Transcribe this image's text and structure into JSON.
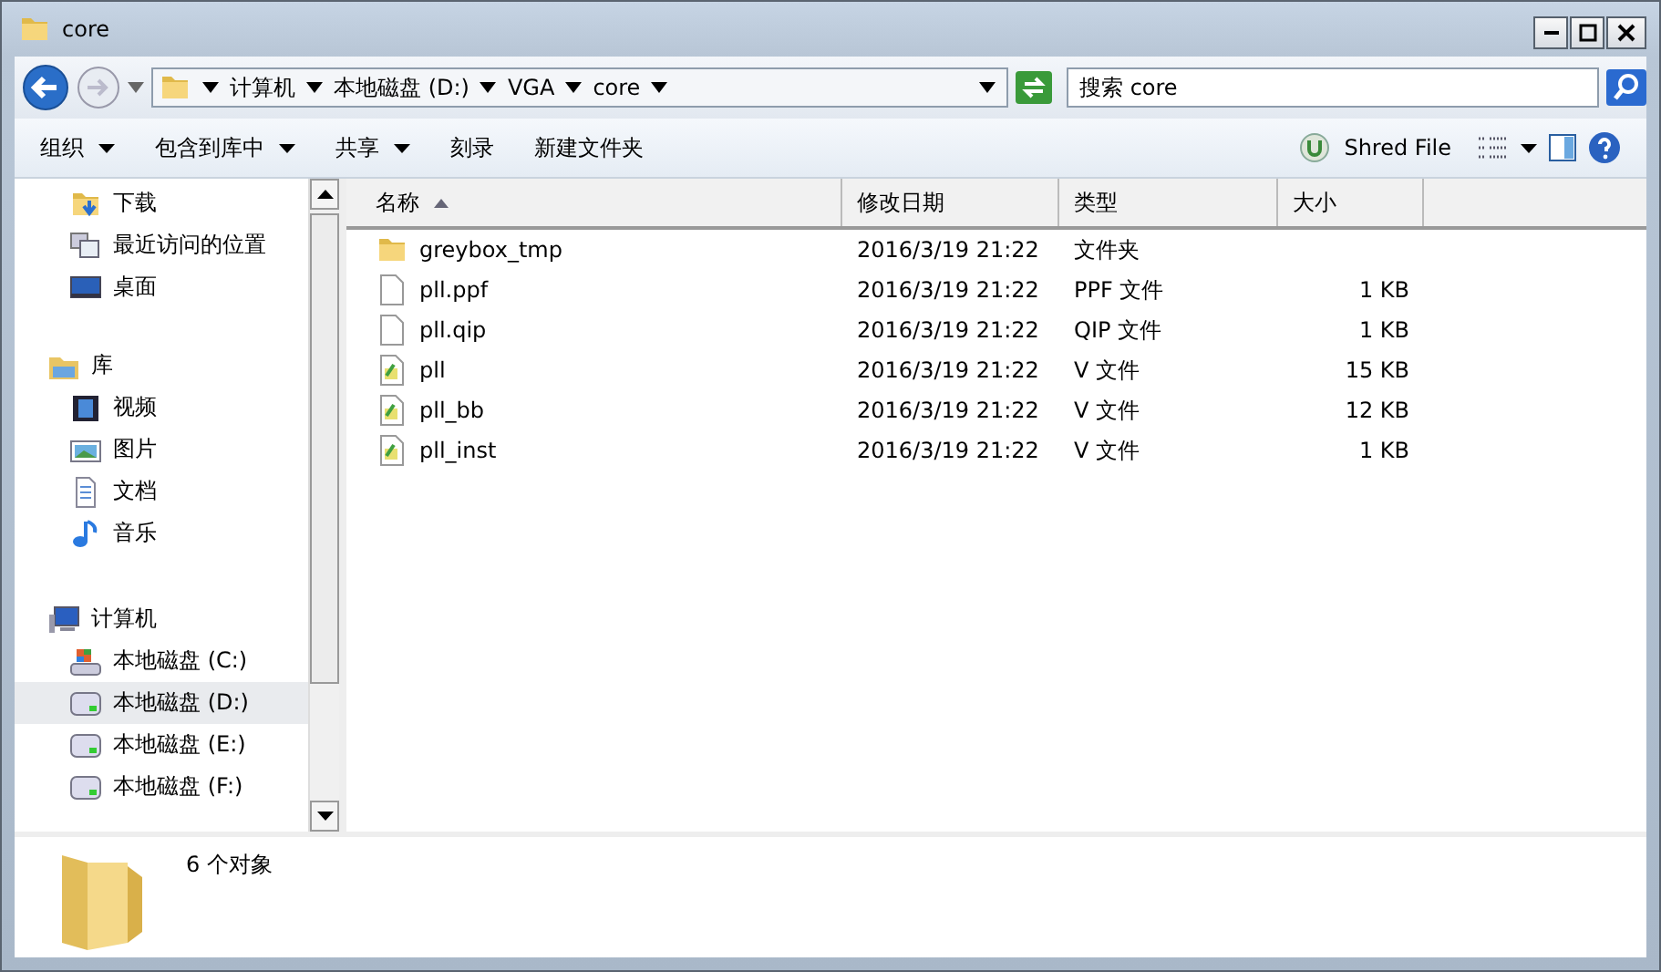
{
  "window": {
    "title": "core"
  },
  "address": {
    "crumbs": [
      "计算机",
      "本地磁盘 (D:)",
      "VGA",
      "core"
    ]
  },
  "search": {
    "placeholder": "搜索 core"
  },
  "toolbar": {
    "items": [
      {
        "label": "组织",
        "dropdown": true
      },
      {
        "label": "包含到库中",
        "dropdown": true
      },
      {
        "label": "共享",
        "dropdown": true
      },
      {
        "label": "刻录",
        "dropdown": false
      },
      {
        "label": "新建文件夹",
        "dropdown": false
      }
    ],
    "shred": "Shred File"
  },
  "sidebar": {
    "groups": [
      {
        "kind": "favorites",
        "children": [
          {
            "label": "下载",
            "kind": "download",
            "selected": false
          },
          {
            "label": "最近访问的位置",
            "kind": "recent",
            "selected": false
          },
          {
            "label": "桌面",
            "kind": "desktop",
            "selected": false
          }
        ]
      },
      {
        "label": "库",
        "kind": "library",
        "children": [
          {
            "label": "视频",
            "kind": "video",
            "selected": false
          },
          {
            "label": "图片",
            "kind": "picture",
            "selected": false
          },
          {
            "label": "文档",
            "kind": "document",
            "selected": false
          },
          {
            "label": "音乐",
            "kind": "music",
            "selected": false
          }
        ]
      },
      {
        "label": "计算机",
        "kind": "computer",
        "children": [
          {
            "label": "本地磁盘 (C:)",
            "kind": "system-drive",
            "selected": false
          },
          {
            "label": "本地磁盘 (D:)",
            "kind": "drive",
            "selected": true
          },
          {
            "label": "本地磁盘 (E:)",
            "kind": "drive",
            "selected": false
          },
          {
            "label": "本地磁盘 (F:)",
            "kind": "drive",
            "selected": false
          }
        ]
      }
    ]
  },
  "table": {
    "columns": [
      {
        "label": "名称",
        "sorted": true
      },
      {
        "label": "修改日期",
        "sorted": false
      },
      {
        "label": "类型",
        "sorted": false
      },
      {
        "label": "大小",
        "sorted": false
      }
    ],
    "rows": [
      {
        "kind": "folder",
        "name": "greybox_tmp",
        "date": "2016/3/19 21:22",
        "type": "文件夹"
      },
      {
        "kind": "file",
        "name": "pll.ppf",
        "date": "2016/3/19 21:22",
        "type": "PPF 文件",
        "size": "1 KB"
      },
      {
        "kind": "file",
        "name": "pll.qip",
        "date": "2016/3/19 21:22",
        "type": "QIP 文件",
        "size": "1 KB"
      },
      {
        "kind": "v-file",
        "name": "pll",
        "date": "2016/3/19 21:22",
        "type": "V 文件",
        "size": "15 KB"
      },
      {
        "kind": "v-file",
        "name": "pll_bb",
        "date": "2016/3/19 21:22",
        "type": "V 文件",
        "size": "12 KB"
      },
      {
        "kind": "v-file",
        "name": "pll_inst",
        "date": "2016/3/19 21:22",
        "type": "V 文件",
        "size": "1 KB"
      }
    ]
  },
  "status_bar": {
    "text": "6 个对象"
  }
}
